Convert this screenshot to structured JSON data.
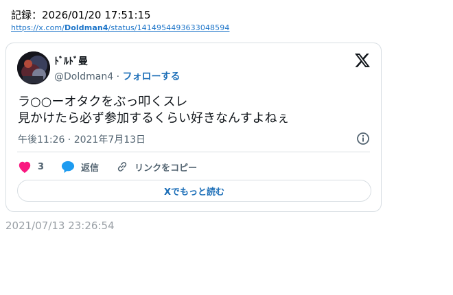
{
  "record": {
    "text": "記録：2026/01/20 17:51:15"
  },
  "source_url": {
    "prefix": "https://x.com/",
    "user": "Doldman4",
    "suffix": "/status/1414954493633048594"
  },
  "tweet": {
    "display_name": "ﾄﾞﾙﾄﾞ曼",
    "handle": "@Doldman4",
    "separator": "·",
    "follow_label": "フォローする",
    "lines": [
      "ラ○○ーオタクをぶっ叩くスレ",
      "見かけたら必ず参加するくらい好きなんすよねぇ"
    ],
    "timestamp": "午後11:26 · 2021年7月13日",
    "like_count": "3",
    "reply_label": "返信",
    "copy_link_label": "リンクをコピー",
    "read_more_label": "Xでもっと読む"
  },
  "archived_time": "2021/07/13 23:26:54",
  "colors": {
    "link": "#1a73c8",
    "accent": "#1d6fb8",
    "like": "#f91880",
    "reply": "#1d9bf0",
    "muted": "#536471"
  },
  "icons": [
    "avatar-image",
    "x-logo-icon",
    "info-icon",
    "heart-icon",
    "reply-bubble-icon",
    "link-icon"
  ]
}
